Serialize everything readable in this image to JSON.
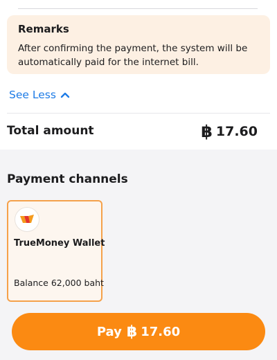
{
  "remarks": {
    "title": "Remarks",
    "text": "After confirming the payment, the system will be automatically paid for the internet bill."
  },
  "toggle": {
    "label": "See Less",
    "icon": "chevron-up-icon"
  },
  "total": {
    "label": "Total amount",
    "currency_symbol": "฿",
    "value": "17.60"
  },
  "payment_channels": {
    "title": "Payment channels",
    "channels": [
      {
        "name": "TrueMoney Wallet",
        "balance": "Balance 62,000 baht",
        "icon": "truemoney-wallet-logo",
        "selected": true
      }
    ]
  },
  "pay_button": {
    "label": "Pay",
    "currency_symbol": "฿",
    "amount": "17.60"
  },
  "colors": {
    "accent": "#fb8a12",
    "link": "#1d7be6",
    "remarks_bg": "#fdf0e3",
    "selected_border": "#f5a14a"
  }
}
